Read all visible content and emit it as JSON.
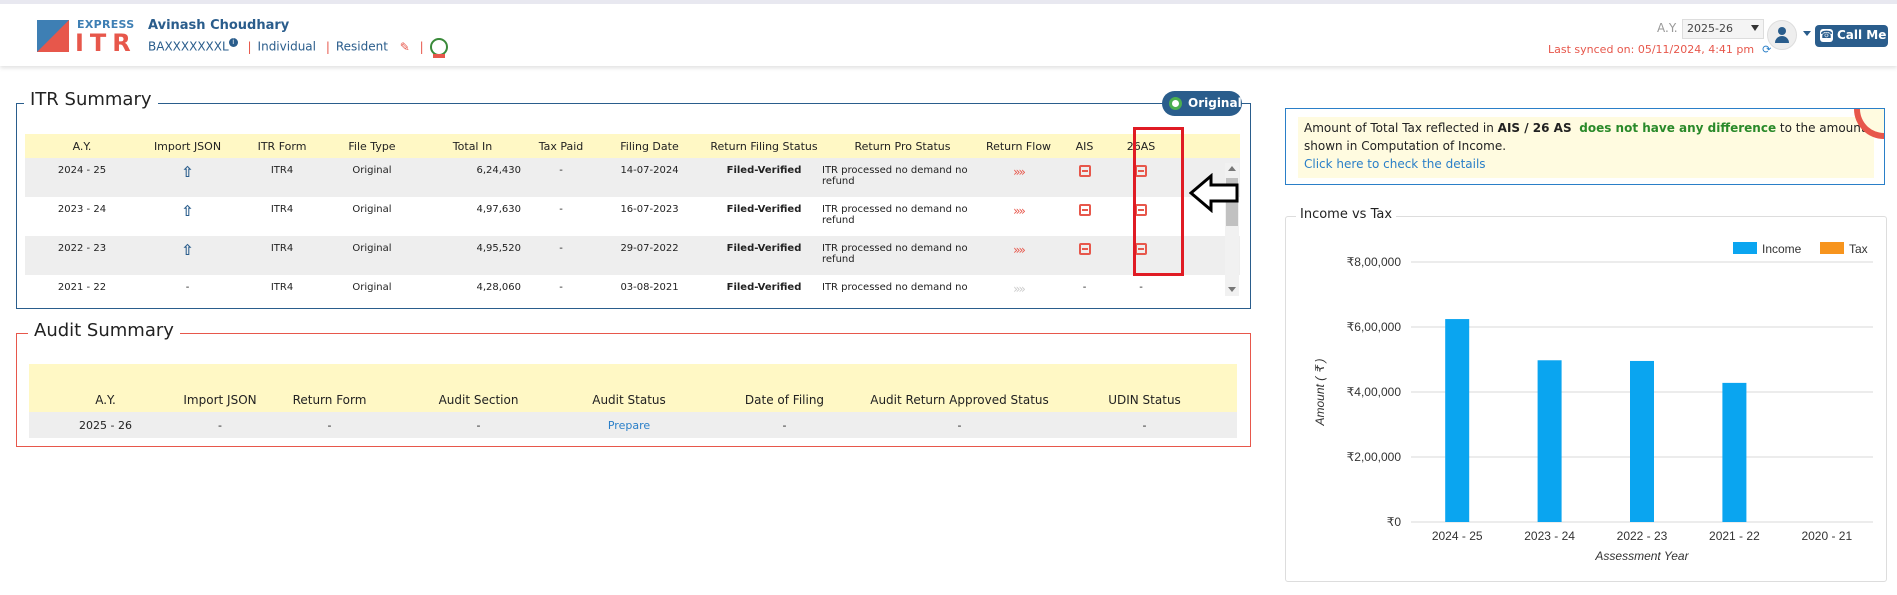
{
  "header": {
    "logo_top": "EXPRESS",
    "logo_main": "ITR",
    "user_name": "Avinash Choudhary",
    "pan": "BAXXXXXXXL",
    "status": "Individual",
    "residency": "Resident",
    "ay_label": "A.Y.",
    "ay_value": "2025-26",
    "call_label": "Call Me",
    "sync_text": "Last synced on: 05/11/2024, 4:41 pm"
  },
  "itr": {
    "title": "ITR Summary",
    "badge": "Original",
    "headers": [
      "A.Y.",
      "Import JSON",
      "ITR Form",
      "File Type",
      "Total In",
      "Tax Paid",
      "Filing Date",
      "Return Filing Status",
      "Return Pro Status",
      "Return Flow",
      "AIS",
      "26AS"
    ],
    "rows": [
      {
        "ay": "2024 - 25",
        "form": "ITR4",
        "type": "Original",
        "income": "6,24,430",
        "tax": "-",
        "date": "14-07-2024",
        "status": "Filed-Verified",
        "pro": "ITR processed no demand no refund"
      },
      {
        "ay": "2023 - 24",
        "form": "ITR4",
        "type": "Original",
        "income": "4,97,630",
        "tax": "-",
        "date": "16-07-2023",
        "status": "Filed-Verified",
        "pro": "ITR processed no demand no refund"
      },
      {
        "ay": "2022 - 23",
        "form": "ITR4",
        "type": "Original",
        "income": "4,95,520",
        "tax": "-",
        "date": "29-07-2022",
        "status": "Filed-Verified",
        "pro": "ITR processed no demand no refund"
      },
      {
        "ay": "2021 - 22",
        "import": "-",
        "form": "ITR4",
        "type": "Original",
        "income": "4,28,060",
        "tax": "-",
        "date": "03-08-2021",
        "status": "Filed-Verified",
        "pro": "ITR processed no demand no",
        "ais": "-",
        "as26": "-"
      }
    ]
  },
  "audit": {
    "title": "Audit Summary",
    "headers": [
      "A.Y.",
      "Import JSON",
      "Return Form",
      "Audit Section",
      "Audit Status",
      "Date of Filing",
      "Audit Return Approved Status",
      "UDIN Status"
    ],
    "row": {
      "ay": "2025 - 26",
      "import": "-",
      "form": "-",
      "section": "-",
      "status": "Prepare",
      "date": "-",
      "approved": "-",
      "udin": "-"
    }
  },
  "notice": {
    "t1": "Amount of Total Tax reflected in ",
    "t2": "AIS / 26 AS",
    "t3": "does not have any difference",
    "t4": " to the amount shown in Computation of Income.",
    "link": "Click here to check the details"
  },
  "chart_data": {
    "type": "bar",
    "title": "Income vs Tax",
    "xlabel": "Assessment Year",
    "ylabel": "Amount ( ₹ )",
    "categories": [
      "2024 - 25",
      "2023 - 24",
      "2022 - 23",
      "2021 - 22",
      "2020 - 21"
    ],
    "series": [
      {
        "name": "Income",
        "color": "#0aa5f0",
        "values": [
          624430,
          497630,
          495520,
          428060,
          0
        ]
      },
      {
        "name": "Tax",
        "color": "#f7941d",
        "values": [
          0,
          0,
          0,
          0,
          0
        ]
      }
    ],
    "ylim": [
      0,
      800000
    ],
    "yticks": [
      0,
      200000,
      400000,
      600000,
      800000
    ],
    "ytick_labels": [
      "₹0",
      "₹2,00,000",
      "₹4,00,000",
      "₹6,00,000",
      "₹8,00,000"
    ],
    "grid": true,
    "legend": "top-right"
  }
}
